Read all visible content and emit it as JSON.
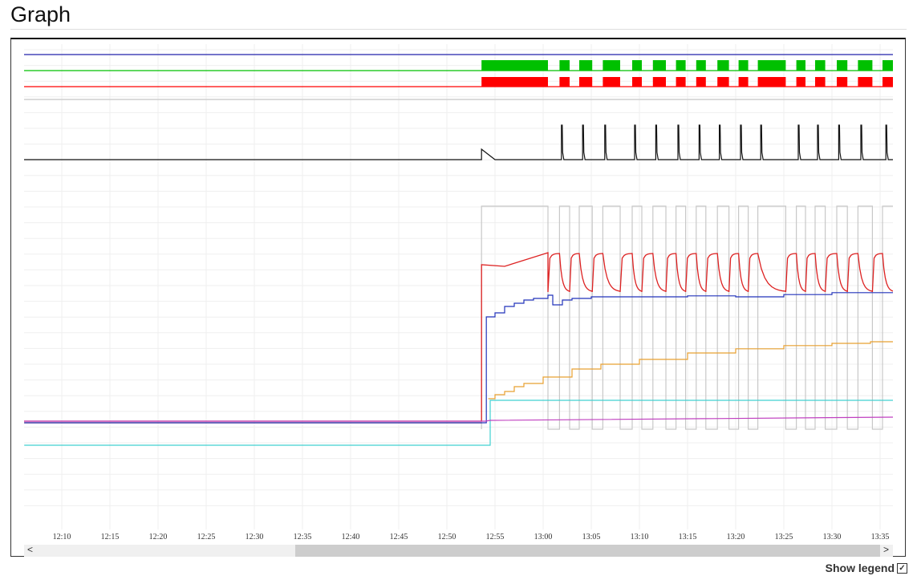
{
  "page": {
    "title": "Graph",
    "show_legend_label": "Show legend",
    "show_legend_checked": true,
    "check_glyph": "✓"
  },
  "chart_data": {
    "type": "line",
    "title": "Graph",
    "xlabel": "",
    "ylabel": "",
    "x_unit": "minutes after 12:00",
    "xlim": [
      6.1,
      96.4
    ],
    "x_ticks": [
      "12:10",
      "12:15",
      "12:20",
      "12:25",
      "12:30",
      "12:35",
      "12:40",
      "12:45",
      "12:50",
      "12:55",
      "13:00",
      "13:05",
      "13:10",
      "13:15",
      "13:20",
      "13:25",
      "13:30",
      "13:35"
    ],
    "x_tick_minutes": [
      10,
      15,
      20,
      25,
      30,
      35,
      40,
      45,
      50,
      55,
      60,
      65,
      70,
      75,
      80,
      85,
      90,
      95
    ],
    "grid": true,
    "on_intervals": [
      [
        53.6,
        60.5
      ],
      [
        61.7,
        62.75
      ],
      [
        63.75,
        65.1
      ],
      [
        66.2,
        68
      ],
      [
        69.25,
        70.25
      ],
      [
        71.4,
        72.75
      ],
      [
        73.8,
        74.8
      ],
      [
        75.9,
        76.9
      ],
      [
        78.1,
        79.3
      ],
      [
        80.3,
        81.3
      ],
      [
        82.3,
        85.2
      ],
      [
        86.3,
        87.25
      ],
      [
        88.25,
        89.3
      ],
      [
        90.5,
        91.6
      ],
      [
        92.7,
        94.2
      ],
      [
        95.25,
        96.4
      ]
    ],
    "spike_times": [
      61.9,
      64.1,
      66.4,
      69.5,
      71.7,
      74,
      76.2,
      78.3,
      80.5,
      82.6,
      86.5,
      88.5,
      90.7,
      93,
      95.6
    ],
    "digital_lanes": [
      {
        "name": "blue-lane",
        "color": "#2222aa",
        "signal": "constant"
      },
      {
        "name": "green-lane",
        "color": "#00c000",
        "signal": "on_intervals"
      },
      {
        "name": "red-lane",
        "color": "#ff0000",
        "signal": "on_intervals"
      }
    ],
    "series": [
      {
        "name": "gray-square",
        "color": "#c8c8c8",
        "type": "square",
        "low": 26.25,
        "high": 95.75,
        "start": 53.6
      },
      {
        "name": "red-temperature",
        "color": "#dd2222",
        "pre": 28.75,
        "jump_at": 53.6,
        "points": [
          [
            53.6,
            77.5
          ],
          [
            56,
            77
          ],
          [
            60.5,
            81.25
          ]
        ],
        "osc_high": 81,
        "osc_low": 69
      },
      {
        "name": "dark-red",
        "color": "#990000",
        "points": [
          [
            6.1,
            28.25
          ],
          [
            53.6,
            28.25
          ]
        ]
      },
      {
        "name": "blue",
        "color": "#2233bb",
        "step": true,
        "points": [
          [
            6.1,
            28.25
          ],
          [
            53.9,
            28.25
          ],
          [
            54.1,
            61.25
          ],
          [
            55,
            62.5
          ],
          [
            56,
            64.5
          ],
          [
            57,
            65.5
          ],
          [
            58,
            66.5
          ],
          [
            59,
            67
          ],
          [
            60.5,
            68
          ],
          [
            61,
            65
          ],
          [
            62,
            66.5
          ],
          [
            63,
            67
          ],
          [
            65,
            67.5
          ],
          [
            70,
            67.5
          ],
          [
            75,
            67.8
          ],
          [
            80,
            67.5
          ],
          [
            85,
            68.2
          ],
          [
            90,
            68.8
          ],
          [
            96.4,
            68
          ]
        ]
      },
      {
        "name": "orange",
        "color": "#e8a030",
        "step": true,
        "points": [
          [
            54.3,
            35.75
          ],
          [
            55,
            37
          ],
          [
            56,
            38
          ],
          [
            57,
            39.5
          ],
          [
            58,
            40.5
          ],
          [
            60,
            42.5
          ],
          [
            63,
            45
          ],
          [
            66,
            46.5
          ],
          [
            70,
            48
          ],
          [
            75,
            50
          ],
          [
            80,
            51.3
          ],
          [
            85,
            52.3
          ],
          [
            90,
            53
          ],
          [
            94,
            53.5
          ],
          [
            96.4,
            53.3
          ]
        ]
      },
      {
        "name": "cyan",
        "color": "#40d0d0",
        "step": true,
        "points": [
          [
            6.1,
            21.25
          ],
          [
            54.5,
            21.25
          ],
          [
            54.5,
            35.25
          ],
          [
            96.4,
            35.25
          ]
        ]
      },
      {
        "name": "magenta",
        "color": "#c040c0",
        "points": [
          [
            6.1,
            28.75
          ],
          [
            54,
            28.75
          ],
          [
            54.5,
            29
          ],
          [
            96.4,
            30
          ]
        ]
      }
    ]
  }
}
